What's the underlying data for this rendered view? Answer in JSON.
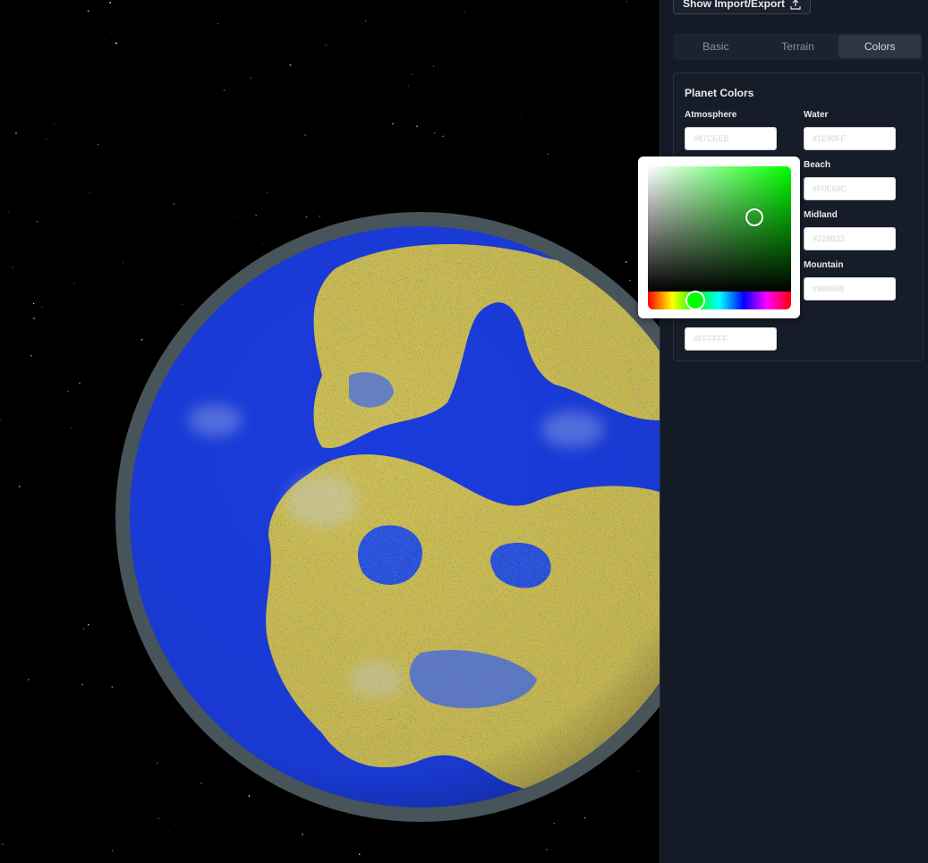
{
  "header": {
    "import_export_label": "Show Import/Export",
    "import_export_icon": "upload-icon"
  },
  "tabs": [
    {
      "label": "Basic",
      "active": false
    },
    {
      "label": "Terrain",
      "active": false
    },
    {
      "label": "Colors",
      "active": true
    }
  ],
  "colors_section": {
    "title": "Planet Colors",
    "fields": {
      "atmosphere": {
        "label": "Atmosphere",
        "value": "#87CEEB",
        "color": "#87CEEB"
      },
      "water": {
        "label": "Water",
        "value": "#1E90FF",
        "color": "#1E90FF"
      },
      "beach": {
        "label": "Beach",
        "value": "#F0E68C",
        "color": "#F0E68C"
      },
      "midland": {
        "label": "Midland",
        "value": "#228B22",
        "color": "#228B22"
      },
      "mountain": {
        "label": "Mountain",
        "value": "#888888",
        "color": "#888888"
      },
      "snow": {
        "value": "#FFFFFF",
        "color": "#FFFFFF"
      }
    }
  },
  "picker": {
    "hue_color": "#00FF00"
  },
  "scene": {
    "space_color": "#000000",
    "ocean_color": "#1a3cdc",
    "land_color": "#d4bd4f",
    "atmosphere_ring_color": "#47545a"
  }
}
